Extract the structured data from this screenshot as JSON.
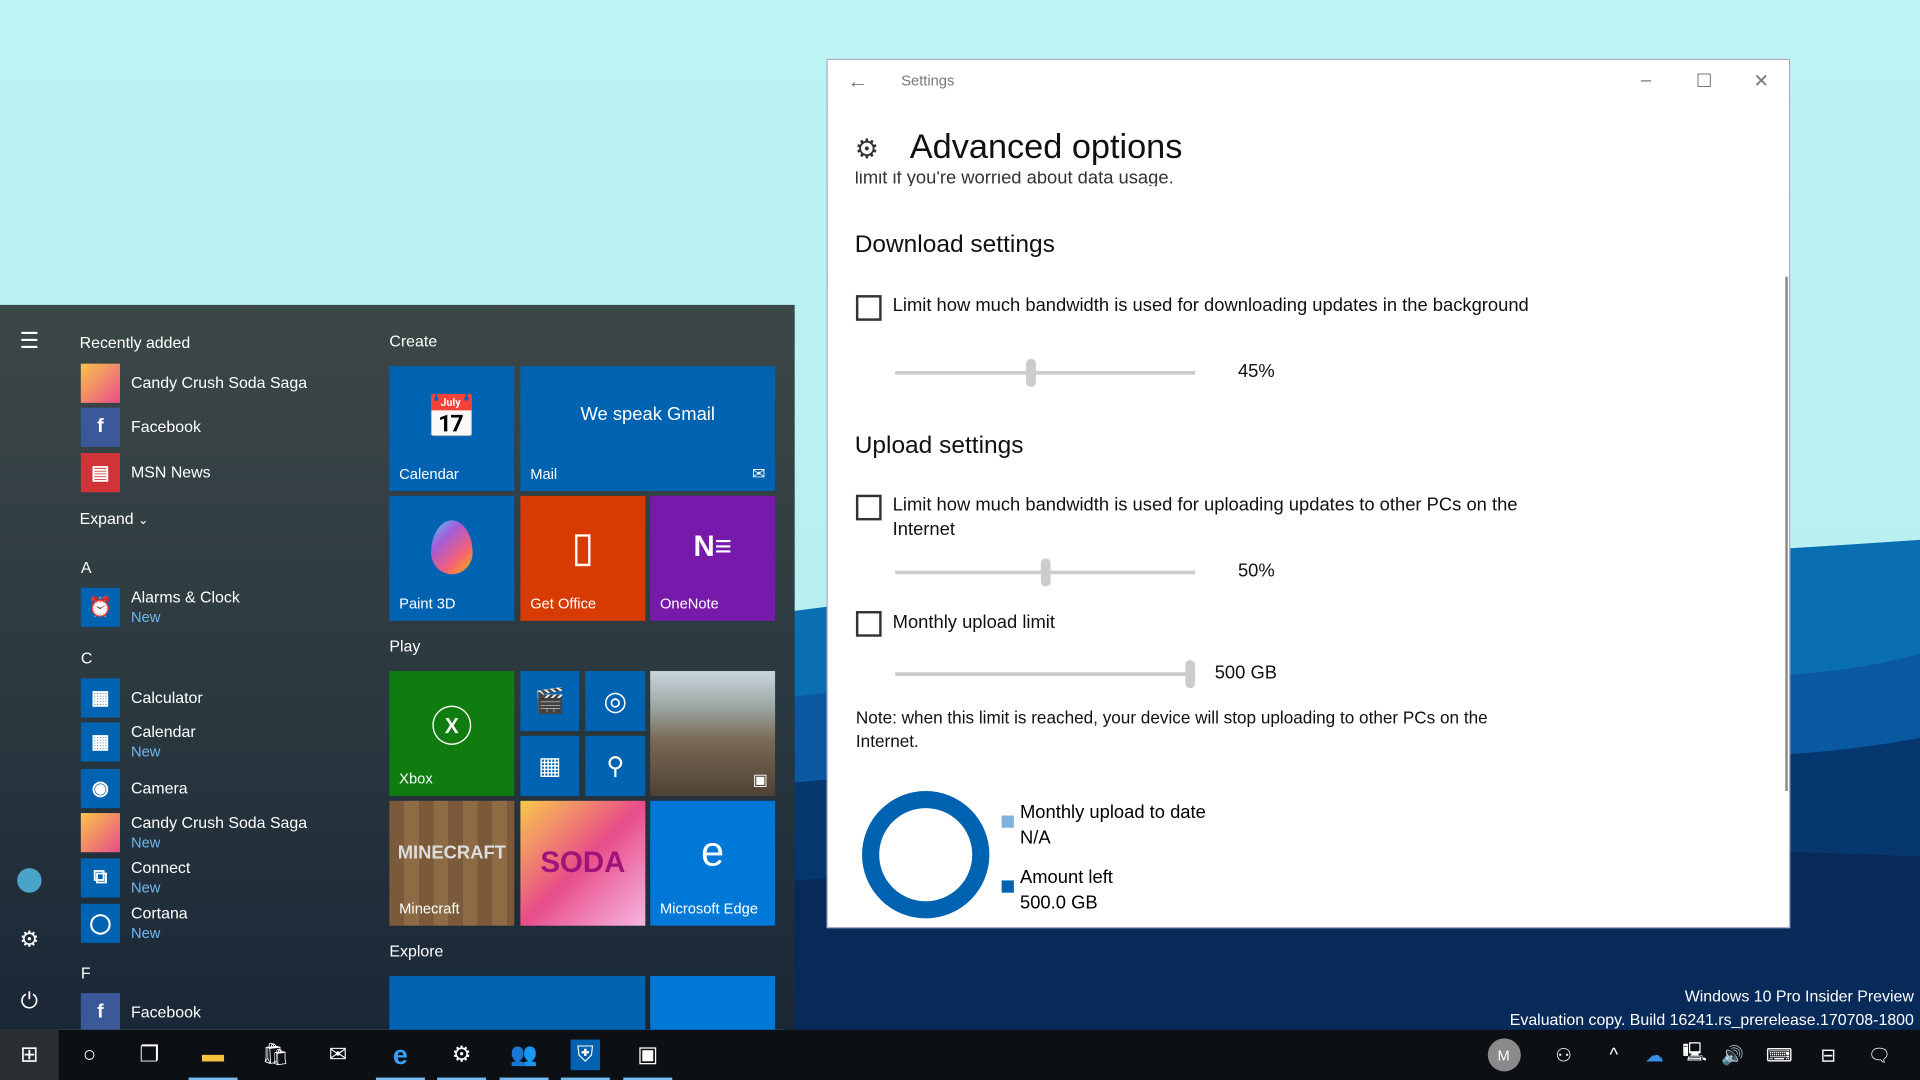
{
  "start_menu": {
    "recently_added_label": "Recently added",
    "recent": [
      {
        "name": "Candy Crush Soda Saga",
        "color": "#4a7bd0"
      },
      {
        "name": "Facebook",
        "color": "#3b5998"
      },
      {
        "name": "MSN News",
        "color": "#d13438"
      }
    ],
    "expand_label": "Expand",
    "groups": [
      {
        "letter": "A",
        "apps": [
          {
            "name": "Alarms & Clock",
            "badge": "New"
          }
        ]
      },
      {
        "letter": "C",
        "apps": [
          {
            "name": "Calculator",
            "badge": ""
          },
          {
            "name": "Calendar",
            "badge": "New"
          },
          {
            "name": "Camera",
            "badge": ""
          },
          {
            "name": "Candy Crush Soda Saga",
            "badge": "New"
          },
          {
            "name": "Connect",
            "badge": "New"
          },
          {
            "name": "Cortana",
            "badge": "New"
          }
        ]
      },
      {
        "letter": "F",
        "apps": [
          {
            "name": "Facebook",
            "badge": ""
          }
        ]
      }
    ],
    "tile_groups": {
      "create": "Create",
      "play": "Play",
      "explore": "Explore"
    },
    "tiles": {
      "calendar": "Calendar",
      "mail": "Mail",
      "mail_headline": "We speak Gmail",
      "paint3d": "Paint 3D",
      "get_office": "Get Office",
      "onenote": "OneNote",
      "xbox": "Xbox",
      "minecraft": "Minecraft",
      "edge": "Microsoft Edge"
    },
    "colors": {
      "tile_blue": "#0063b1",
      "office": "#d83b01",
      "onenote": "#7719aa",
      "xbox": "#107c10",
      "edge": "#0078d7"
    }
  },
  "settings": {
    "window_title": "Settings",
    "page_title": "Advanced options",
    "cut_text": "limit if you're worried about data usage.",
    "download_heading": "Download settings",
    "download_checkbox": "Limit how much bandwidth is used for downloading updates in the background",
    "download_checked": false,
    "download_percent": 45,
    "download_value": "45%",
    "upload_heading": "Upload settings",
    "upload_checkbox": "Limit how much bandwidth is used for uploading updates to other PCs on the Internet",
    "upload_checked": false,
    "upload_percent": 50,
    "upload_value": "50%",
    "monthly_checkbox": "Monthly upload limit",
    "monthly_checked": false,
    "monthly_percent": 100,
    "monthly_value": "500 GB",
    "note": "Note: when this limit is reached, your device will stop uploading to other PCs on the Internet.",
    "legend": [
      {
        "label": "Monthly upload to date",
        "value": "N/A",
        "color": "#7fb2dc"
      },
      {
        "label": "Amount left",
        "value": "500.0 GB",
        "color": "#0063b1"
      }
    ]
  },
  "watermark": {
    "line1": "Windows 10 Pro Insider Preview",
    "line2": "Evaluation copy. Build 16241.rs_prerelease.170708-1800"
  },
  "taskbar": {
    "tray_avatar": "M",
    "accent": "#76b9ed"
  }
}
